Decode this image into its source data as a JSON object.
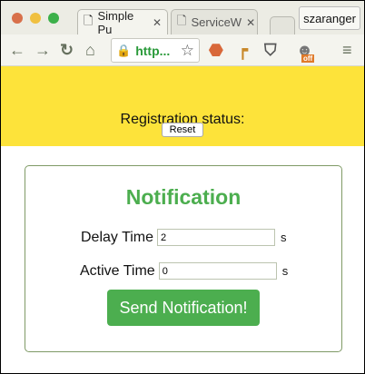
{
  "browser": {
    "tabs": [
      {
        "title": "Simple Pu",
        "icon": "page-icon",
        "active": true
      },
      {
        "title": "ServiceW",
        "icon": "page-icon",
        "active": false
      }
    ],
    "user": "szaranger",
    "url": "http...",
    "extensions": [
      "ublock-icon",
      "crane-icon",
      "pocket-icon",
      "ghostery-icon"
    ],
    "extension_badge": "off"
  },
  "registration": {
    "status_label": "Registration status:",
    "reset_label": "Reset"
  },
  "notification": {
    "title": "Notification",
    "delay_label": "Delay Time",
    "delay_value": "2",
    "delay_unit": "s",
    "active_label": "Active Time",
    "active_value": "0",
    "active_unit": "s",
    "send_label": "Send Notification!"
  },
  "colors": {
    "accent": "#4cae4f",
    "banner": "#fde33a"
  }
}
